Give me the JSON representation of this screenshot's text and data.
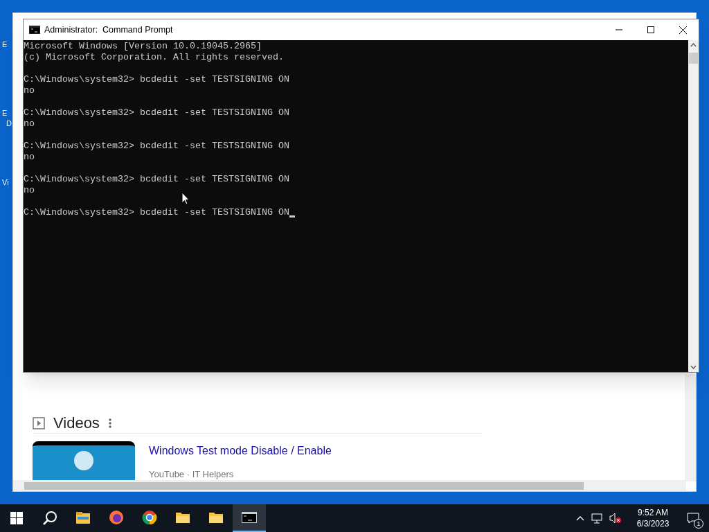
{
  "desktop_icons": [
    {
      "label": "E"
    },
    {
      "label": "E"
    },
    {
      "label": "D"
    },
    {
      "label": "Vi"
    }
  ],
  "browser": {
    "section_title": "Videos",
    "video": {
      "title": "Windows Test mode Disable / Enable",
      "source": "YouTube · IT Helpers"
    }
  },
  "console_window": {
    "title": "Administrator:  Command Prompt",
    "blocks": [
      [
        "Microsoft Windows [Version 10.0.19045.2965]",
        "(c) Microsoft Corporation. All rights reserved."
      ],
      [
        "C:\\Windows\\system32> bcdedit -set TESTSIGNING ON",
        "no"
      ],
      [
        "C:\\Windows\\system32> bcdedit -set TESTSIGNING ON",
        "no"
      ],
      [
        "C:\\Windows\\system32> bcdedit -set TESTSIGNING ON",
        "no"
      ],
      [
        "C:\\Windows\\system32> bcdedit -set TESTSIGNING ON",
        "no"
      ],
      [
        "C:\\Windows\\system32> bcdedit -set TESTSIGNING ON"
      ]
    ],
    "cursor": true
  },
  "taskbar": {
    "apps": [
      {
        "kind": "explorer",
        "selected": false
      },
      {
        "kind": "firefox",
        "selected": false
      },
      {
        "kind": "chrome",
        "selected": false
      },
      {
        "kind": "folder",
        "selected": false
      },
      {
        "kind": "folder",
        "selected": false
      },
      {
        "kind": "console",
        "selected": true
      }
    ],
    "time": "9:52 AM",
    "date": "6/3/2023",
    "notifications": "1"
  }
}
